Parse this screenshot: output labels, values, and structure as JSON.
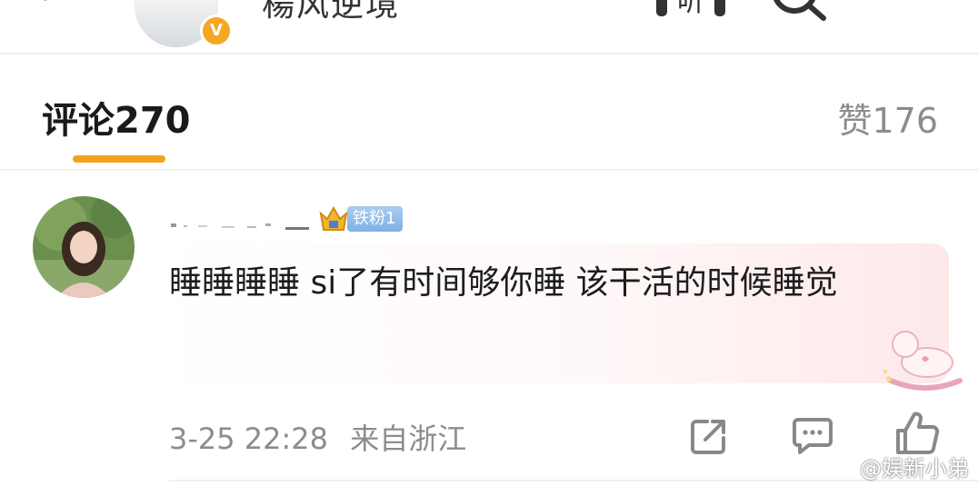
{
  "header": {
    "title": "楊风逆境",
    "badge_letter": "V"
  },
  "tabs": {
    "comments_label": "评论",
    "comments_count": "270",
    "likes_label": "赞",
    "likes_count": "176"
  },
  "comment": {
    "badge_label": "铁粉1",
    "text": "睡睡睡睡 si了有时间够你睡 该干活的时候睡觉",
    "timestamp": "3-25 22:28",
    "location": "来自浙江"
  },
  "watermark": "@娱新小弟",
  "colors": {
    "accent": "#f4a11f",
    "badge_blue": "#7fb1e3",
    "muted_text": "#8c8c8c"
  }
}
